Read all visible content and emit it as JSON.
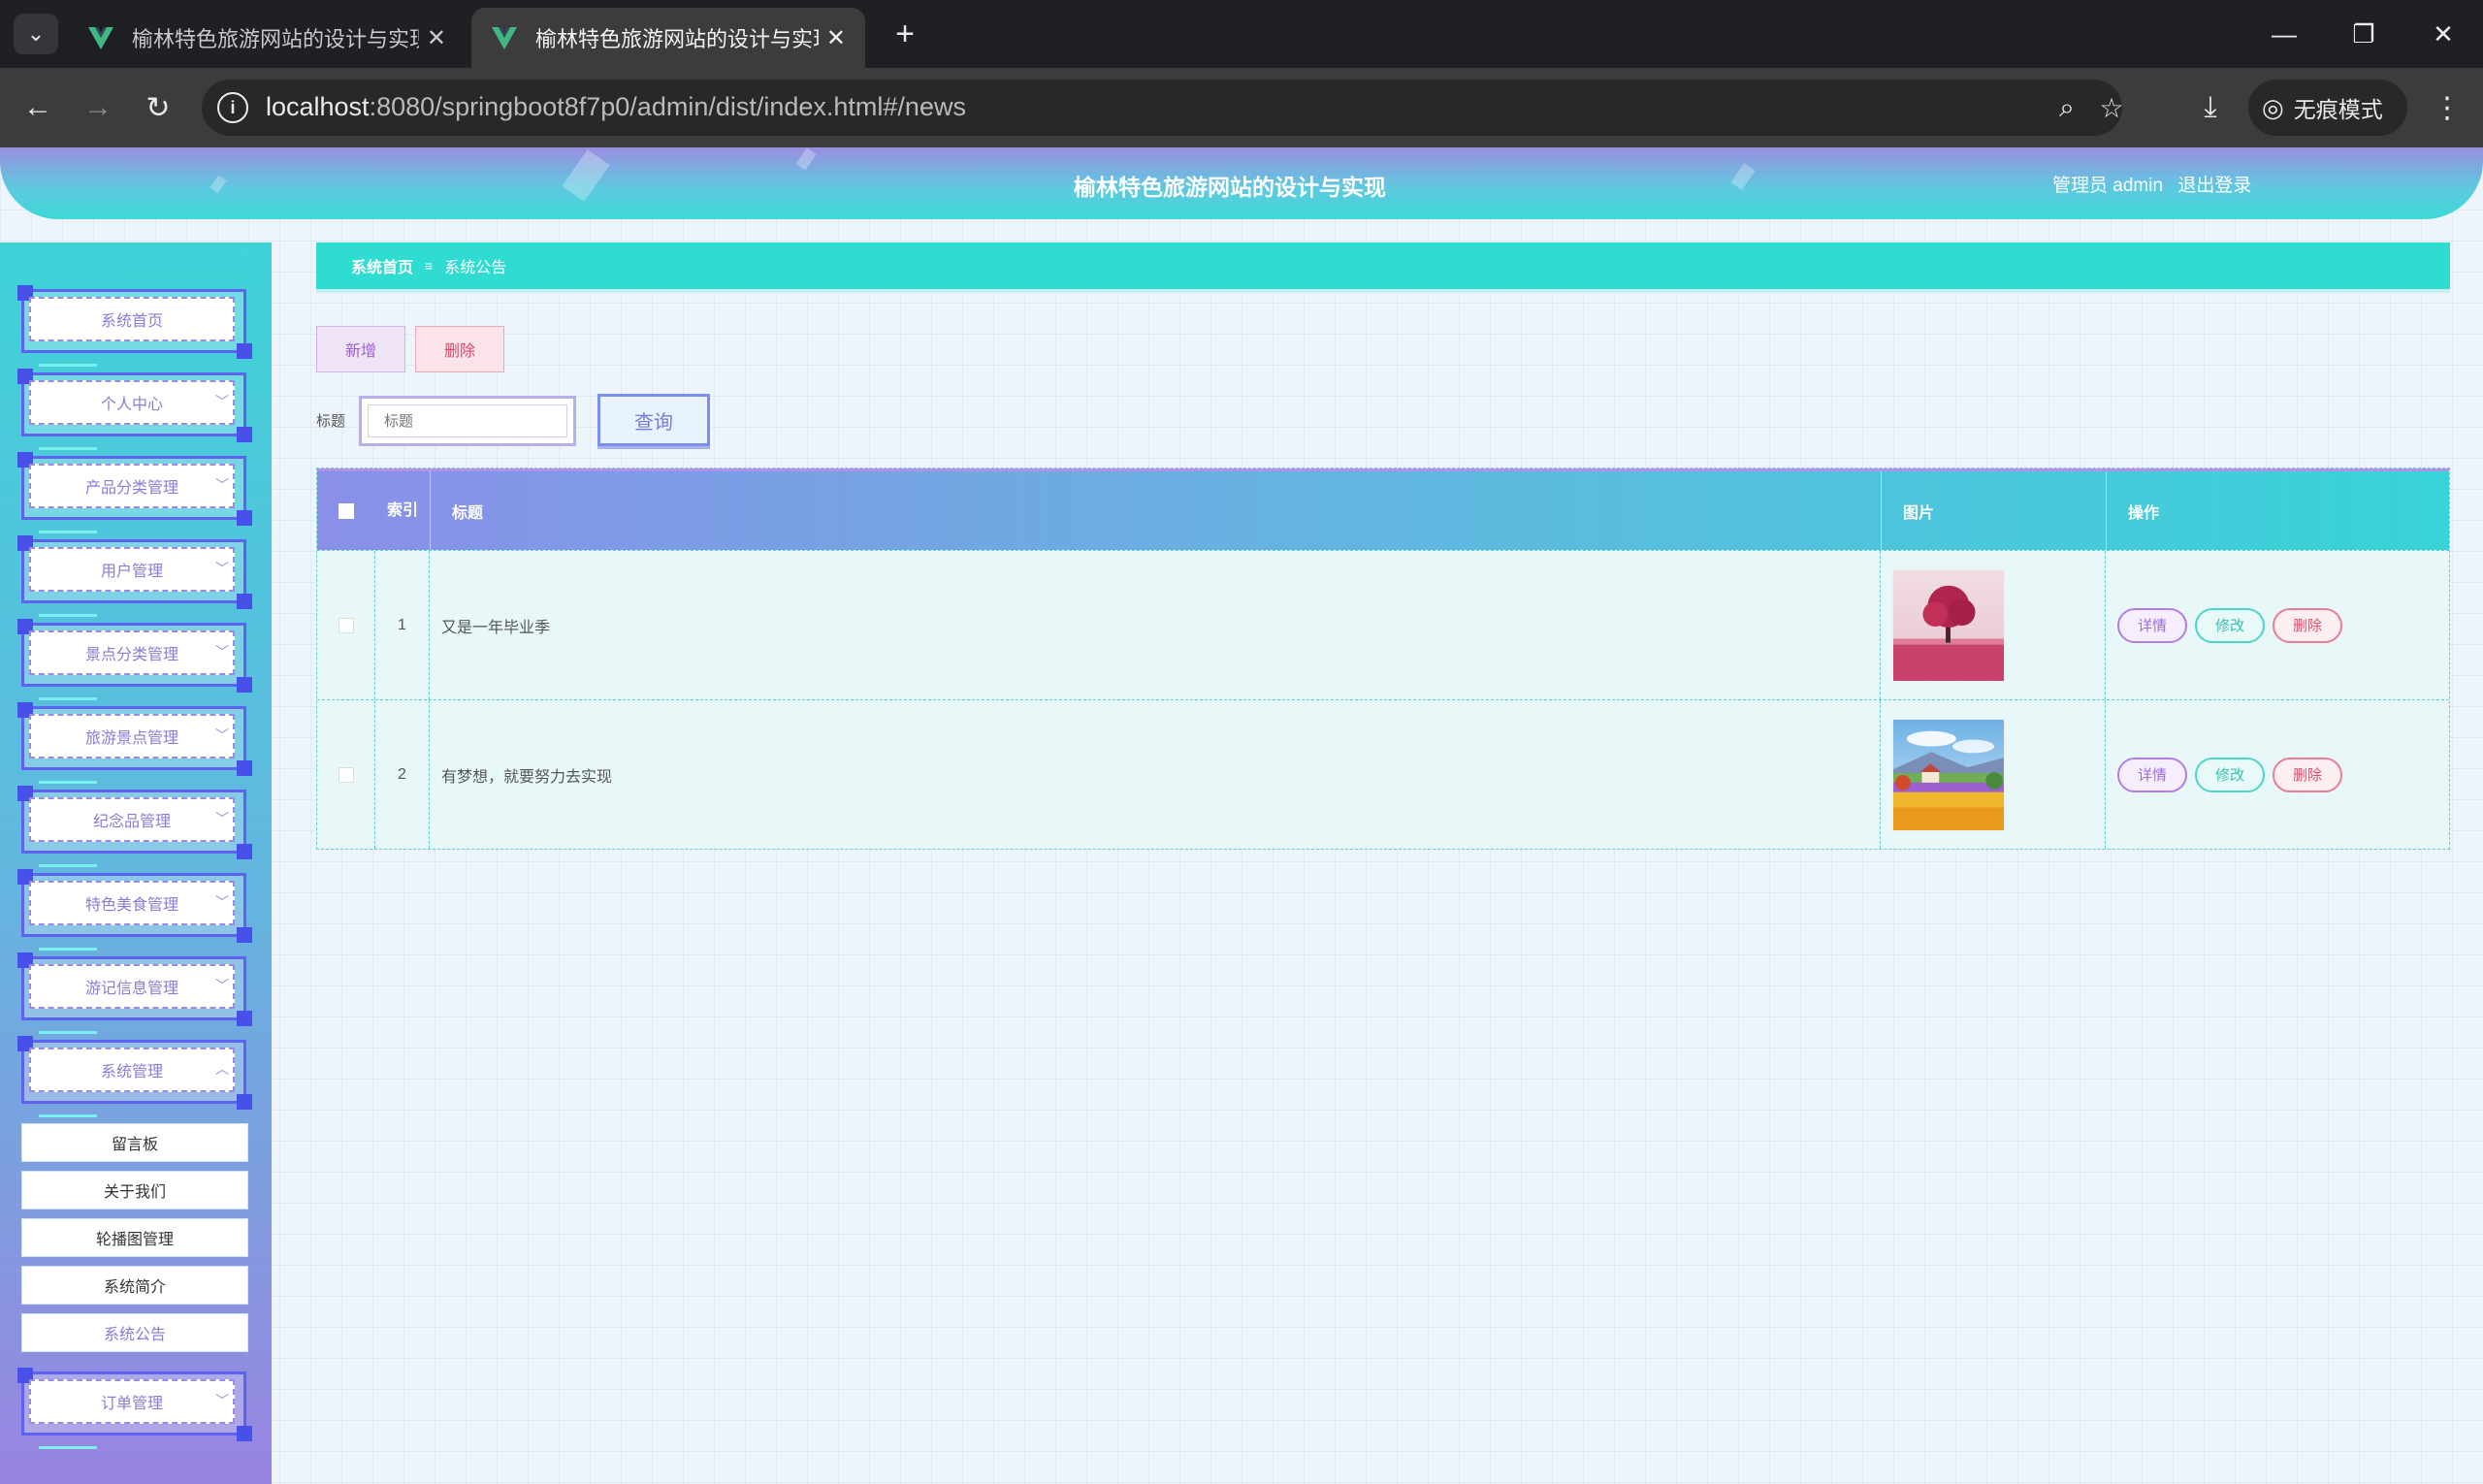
{
  "browser": {
    "tabs": [
      {
        "title": "榆林特色旅游网站的设计与实现",
        "active": false
      },
      {
        "title": "榆林特色旅游网站的设计与实现",
        "active": true
      }
    ],
    "url_host": "localhost",
    "url_rest": ":8080/springboot8f7p0/admin/dist/index.html#/news",
    "incognito_label": "无痕模式"
  },
  "header": {
    "site_title": "榆林特色旅游网站的设计与实现",
    "user_label": "管理员 admin",
    "logout_label": "退出登录"
  },
  "sidebar": {
    "items": [
      {
        "label": "系统首页",
        "has_arrow": false
      },
      {
        "label": "个人中心",
        "has_arrow": true
      },
      {
        "label": "产品分类管理",
        "has_arrow": true
      },
      {
        "label": "用户管理",
        "has_arrow": true
      },
      {
        "label": "景点分类管理",
        "has_arrow": true
      },
      {
        "label": "旅游景点管理",
        "has_arrow": true
      },
      {
        "label": "纪念品管理",
        "has_arrow": true
      },
      {
        "label": "特色美食管理",
        "has_arrow": true
      },
      {
        "label": "游记信息管理",
        "has_arrow": true
      },
      {
        "label": "系统管理",
        "has_arrow": true,
        "expanded": true
      }
    ],
    "sub_items": [
      {
        "label": "留言板"
      },
      {
        "label": "关于我们"
      },
      {
        "label": "轮播图管理"
      },
      {
        "label": "系统简介"
      },
      {
        "label": "系统公告",
        "active": true
      }
    ],
    "last_item": {
      "label": "订单管理"
    }
  },
  "breadcrumb": {
    "home": "系统首页",
    "separator": "≡",
    "current": "系统公告"
  },
  "actions": {
    "add_label": "新增",
    "delete_label": "删除"
  },
  "search": {
    "label": "标题",
    "placeholder": "标题",
    "query_label": "查询"
  },
  "table": {
    "headers": {
      "index": "索引",
      "title": "标题",
      "image": "图片",
      "operation": "操作"
    },
    "rows": [
      {
        "index": "1",
        "title": "又是一年毕业季"
      },
      {
        "index": "2",
        "title": "有梦想，就要努力去实现"
      }
    ],
    "row_actions": {
      "detail": "详情",
      "edit": "修改",
      "delete": "删除"
    }
  },
  "colors": {
    "accent_teal": "#2fdcd2",
    "accent_purple": "#9a83e0",
    "accent_blue": "#5d63f0"
  }
}
